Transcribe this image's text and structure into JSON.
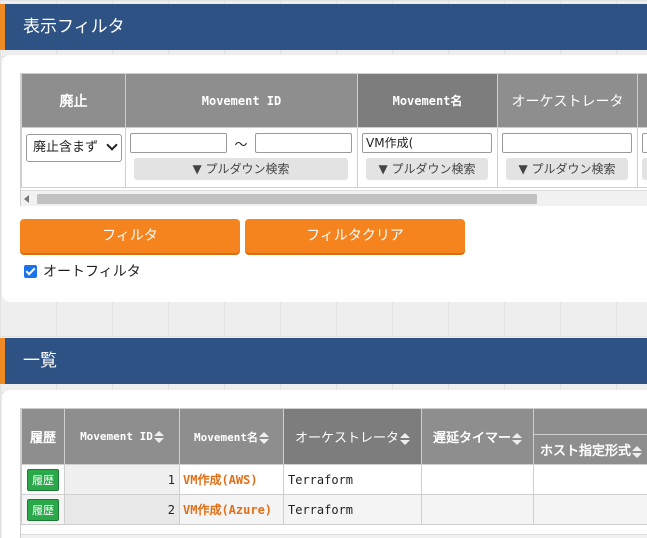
{
  "filter_section": {
    "title": "表示フィルタ",
    "columns": {
      "discard": "廃止",
      "movement_id": "Movement ID",
      "movement_name": "Movement名",
      "orchestrator": "オーケストレータ"
    },
    "discard_select": "廃止含まず",
    "range_sep": "～",
    "movement_name_value": "VM作成(",
    "pulldown_label": "▼ プルダウン検索",
    "filter_button": "フィルタ",
    "clear_button": "フィルタクリア",
    "auto_filter_label": "オートフィルタ",
    "auto_filter_checked": true
  },
  "list_section": {
    "title": "一覧",
    "columns": {
      "history": "履歴",
      "movement_id": "Movement ID",
      "movement_name": "Movement名",
      "orchestrator": "オーケストレータ",
      "delay_timer": "遅延タイマー",
      "host_spec": "ホスト指定形式"
    },
    "history_button": "履歴",
    "rows": [
      {
        "id": "1",
        "name": "VM作成(AWS)",
        "orchestrator": "Terraform"
      },
      {
        "id": "2",
        "name": "VM作成(Azure)",
        "orchestrator": "Terraform"
      }
    ]
  },
  "colors": {
    "header": "#2e5283",
    "accent": "#f5841f",
    "history_green": "#2aa84a"
  }
}
